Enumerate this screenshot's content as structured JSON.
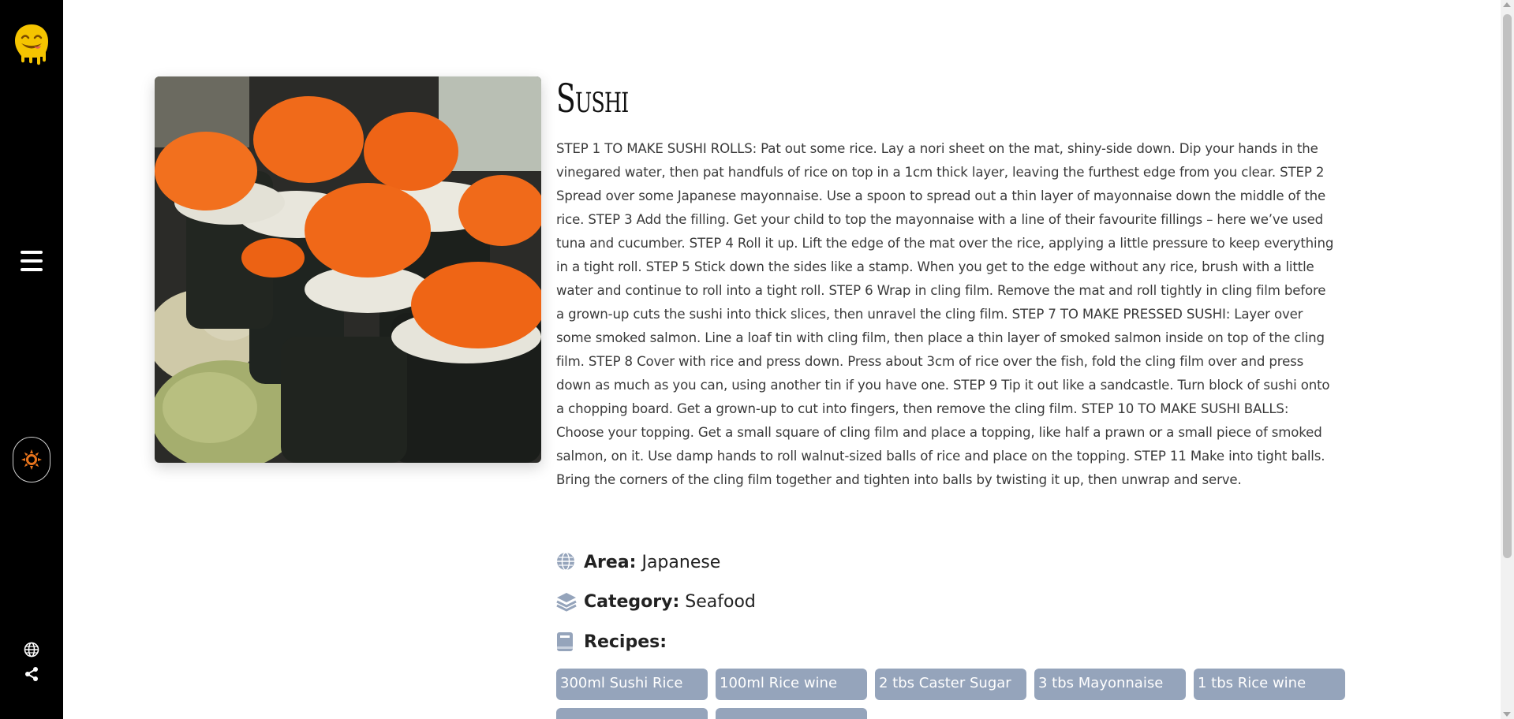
{
  "sidebar": {
    "logo_icon": "smiley-drip-logo",
    "menu_icon": "hamburger-icon",
    "theme_icon": "sun-icon",
    "language_icon": "globe-icon",
    "share_icon": "share-icon",
    "accent_color": "#f5c400"
  },
  "recipe": {
    "title": "Sushi",
    "instructions": "STEP 1 TO MAKE SUSHI ROLLS: Pat out some rice. Lay a nori sheet on the mat, shiny-side down. Dip your hands in the vinegared water, then pat handfuls of rice on top in a 1cm thick layer, leaving the furthest edge from you clear. STEP 2 Spread over some Japanese mayonnaise. Use a spoon to spread out a thin layer of mayonnaise down the middle of the rice. STEP 3 Add the filling. Get your child to top the mayonnaise with a line of their favourite fillings – here we’ve used tuna and cucumber. STEP 4 Roll it up. Lift the edge of the mat over the rice, applying a little pressure to keep everything in a tight roll. STEP 5 Stick down the sides like a stamp. When you get to the edge without any rice, brush with a little water and continue to roll into a tight roll. STEP 6 Wrap in cling film. Remove the mat and roll tightly in cling film before a grown-up cuts the sushi into thick slices, then unravel the cling film. STEP 7 TO MAKE PRESSED SUSHI: Layer over some smoked salmon. Line a loaf tin with cling film, then place a thin layer of smoked salmon inside on top of the cling film. STEP 8 Cover with rice and press down. Press about 3cm of rice over the fish, fold the cling film over and press down as much as you can, using another tin if you have one. STEP 9 Tip it out like a sandcastle. Turn block of sushi onto a chopping board. Get a grown-up to cut into fingers, then remove the cling film. STEP 10 TO MAKE SUSHI BALLS: Choose your topping. Get a small square of cling film and place a topping, like half a prawn or a small piece of smoked salmon, on it. Use damp hands to roll walnut-sized balls of rice and place on the topping. STEP 11 Make into tight balls. Bring the corners of the cling film together and tighten into balls by twisting it up, then unwrap and serve.",
    "area_label": "Area:",
    "area_value": "Japanese",
    "area_icon": "globe-icon",
    "category_label": "Category:",
    "category_value": "Seafood",
    "category_icon": "layers-icon",
    "recipes_label": "Recipes:",
    "recipes_icon": "book-icon",
    "chip_color": "#95a4bb",
    "ingredients": [
      "300ml Sushi Rice",
      "100ml Rice wine",
      "2 tbs Caster Sugar",
      "3 tbs Mayonnaise",
      "1 tbs Rice wine",
      "",
      ""
    ]
  }
}
